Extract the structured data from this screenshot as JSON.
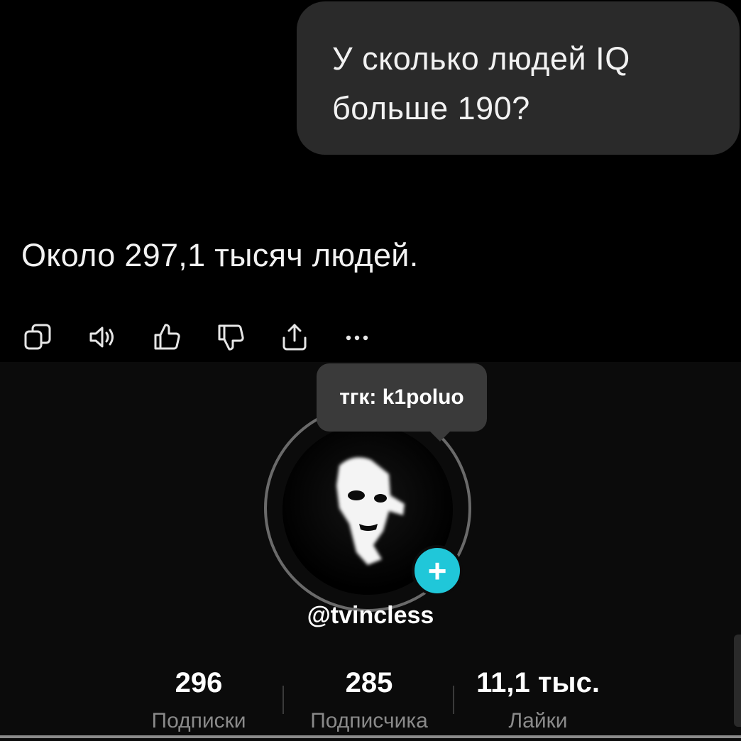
{
  "chat": {
    "user_message_line1": "У сколько людей IQ",
    "user_message_line2": "больше 190?",
    "assistant_answer": "Около 297,1 тысяч людей.",
    "actions": [
      "copy-icon",
      "speaker-icon",
      "thumbs-up-icon",
      "thumbs-down-icon",
      "share-icon",
      "more-icon"
    ]
  },
  "profile": {
    "tooltip": "тгк: k1poluo",
    "username": "@tvincless",
    "stats": [
      {
        "value": "296",
        "label": "Подписки"
      },
      {
        "value": "285",
        "label": "Подписчика"
      },
      {
        "value": "11,1 тыс.",
        "label": "Лайки"
      }
    ],
    "follow_badge": "+",
    "accent_color": "#20c7d9"
  }
}
